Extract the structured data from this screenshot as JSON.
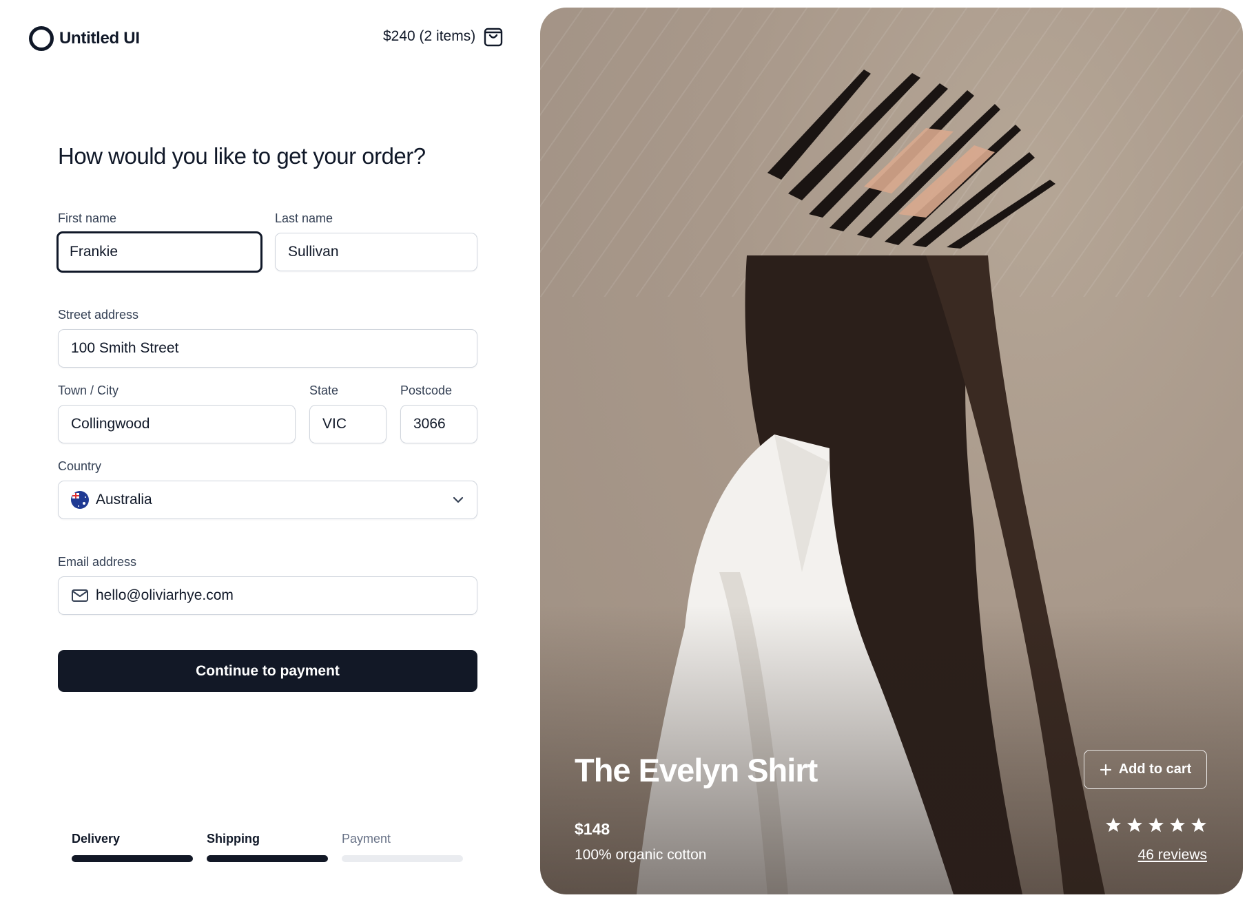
{
  "brand": {
    "name": "Untitled UI"
  },
  "cart": {
    "summary": "$240 (2 items)"
  },
  "form": {
    "heading": "How would you like to get your order?",
    "first_name": {
      "label": "First name",
      "value": "Frankie"
    },
    "last_name": {
      "label": "Last name",
      "value": "Sullivan"
    },
    "street": {
      "label": "Street address",
      "value": "100 Smith Street"
    },
    "city": {
      "label": "Town / City",
      "value": "Collingwood"
    },
    "state": {
      "label": "State",
      "value": "VIC"
    },
    "postcode": {
      "label": "Postcode",
      "value": "3066"
    },
    "country": {
      "label": "Country",
      "value": "Australia"
    },
    "email": {
      "label": "Email address",
      "value": "hello@oliviarhye.com"
    },
    "submit_label": "Continue to payment"
  },
  "steps": [
    {
      "label": "Delivery",
      "complete": true
    },
    {
      "label": "Shipping",
      "complete": true
    },
    {
      "label": "Payment",
      "complete": false
    }
  ],
  "product": {
    "name": "The Evelyn Shirt",
    "add_to_cart_label": "Add to cart",
    "price": "$148",
    "material": "100% organic cotton",
    "rating": 5,
    "reviews_label": "46 reviews"
  },
  "colors": {
    "primary": "#121826",
    "border": "#d0d5dd",
    "photo_background": "#a8988a"
  }
}
